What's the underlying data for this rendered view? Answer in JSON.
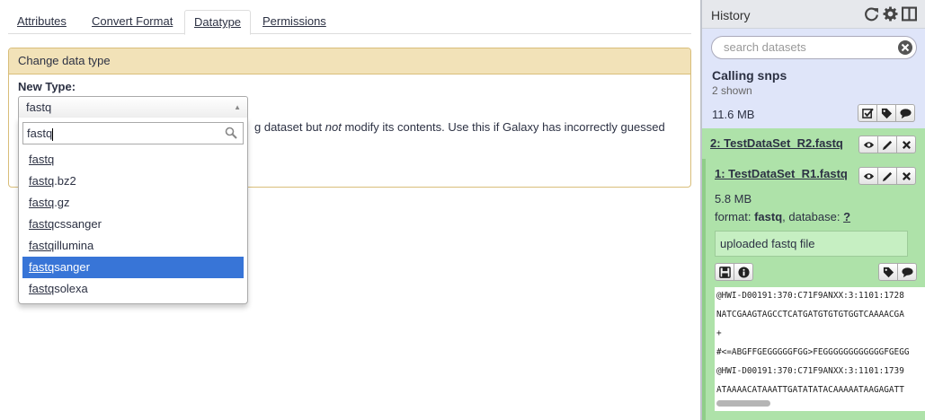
{
  "tabs": [
    {
      "label": "Attributes"
    },
    {
      "label": "Convert Format"
    },
    {
      "label": "Datatype"
    },
    {
      "label": "Permissions"
    }
  ],
  "panel": {
    "title": "Change data type",
    "field_label": "New Type:",
    "selected_value": "fastq",
    "help_before": "g dataset but ",
    "help_em": "not",
    "help_after": " modify its contents. Use this if Galaxy has incorrectly guessed"
  },
  "dropdown": {
    "search_value": "fastq",
    "options": [
      {
        "match": "fastq",
        "rest": ""
      },
      {
        "match": "fastq",
        "rest": ".bz2"
      },
      {
        "match": "fastq",
        "rest": ".gz"
      },
      {
        "match": "fastq",
        "rest": "cssanger"
      },
      {
        "match": "fastq",
        "rest": "illumina"
      },
      {
        "match": "fastq",
        "rest": "sanger"
      },
      {
        "match": "fastq",
        "rest": "solexa"
      }
    ]
  },
  "history": {
    "title": "History",
    "search_placeholder": "search datasets",
    "name": "Calling snps",
    "shown": "2 shown",
    "size": "11.6 MB",
    "datasets": [
      {
        "title": "2: TestDataSet_R2.fastq"
      },
      {
        "title": "1: TestDataSet_R1.fastq",
        "size": "5.8 MB",
        "format_label": "format: ",
        "format": "fastq",
        "db_label": ", database: ",
        "db": "?",
        "info": "uploaded fastq file",
        "peek": [
          "@HWI-D00191:370:C71F9ANXX:3:1101:1728",
          "NATCGAAGTAGCCTCATGATGTGTGTGGTCAAAACGA",
          "+",
          "#<=ABGFFGEGGGGGFGG>FEGGGGGGGGGGGGFGEGG",
          "@HWI-D00191:370:C71F9ANXX:3:1101:1739",
          "ATAAAACATAAATTGATATATACAAAAATAAGAGATT"
        ]
      }
    ]
  },
  "colors": {
    "panel_header": "#f2e2b8",
    "highlight": "#3875d7",
    "history_bg": "#dfe5f9",
    "dataset_ok": "#aee2a9"
  }
}
